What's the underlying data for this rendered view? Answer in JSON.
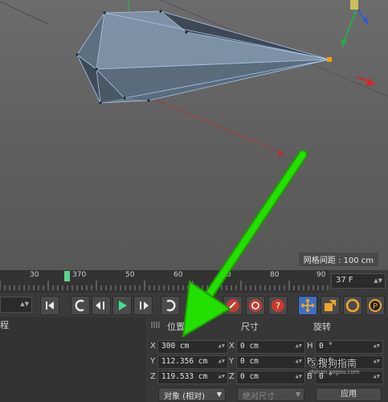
{
  "viewport": {
    "grid_spacing_label": "网格间距 : 100 cm"
  },
  "timeline": {
    "ticks": [
      "30",
      "370",
      "50",
      "60",
      "70",
      "80",
      "90"
    ],
    "current_frame": "37 F"
  },
  "transport": {
    "icons": [
      "go-to-start-icon",
      "rewind-icon",
      "previous-frame-icon",
      "play-icon",
      "next-frame-icon",
      "forward-icon"
    ],
    "key_icons": [
      "record-key-icon",
      "autokey-icon",
      "help-icon"
    ],
    "tool_icons": [
      "move-tool-icon",
      "scale-tool-icon",
      "rotate-tool-icon",
      "parameter-icon"
    ]
  },
  "left_panel": {
    "header": "程"
  },
  "coordinates": {
    "headers": {
      "position": "位置",
      "size": "尺寸",
      "rotation": "旋转"
    },
    "rows": [
      {
        "axis": "X",
        "pos": "300 cm",
        "size_axis": "X",
        "size": "0 cm",
        "rot_axis": "H",
        "rot": "0 °"
      },
      {
        "axis": "Y",
        "pos": "112.356 cm",
        "size_axis": "Y",
        "size": "0 cm",
        "rot_axis": "P",
        "rot": "0 °"
      },
      {
        "axis": "Z",
        "pos": "119.533 cm",
        "size_axis": "Z",
        "size": "0 cm",
        "rot_axis": "B",
        "rot": "0 °"
      }
    ],
    "mode_object": "对象 (相对)",
    "mode_size": "绝对尺寸",
    "apply": "应用"
  },
  "watermark": {
    "text": "搜狗指南",
    "url": "zhinan.sogou.com"
  },
  "colors": {
    "annotation_arrow": "#22e000",
    "playhead": "#5fd28c",
    "pivot": "#f39c12"
  }
}
